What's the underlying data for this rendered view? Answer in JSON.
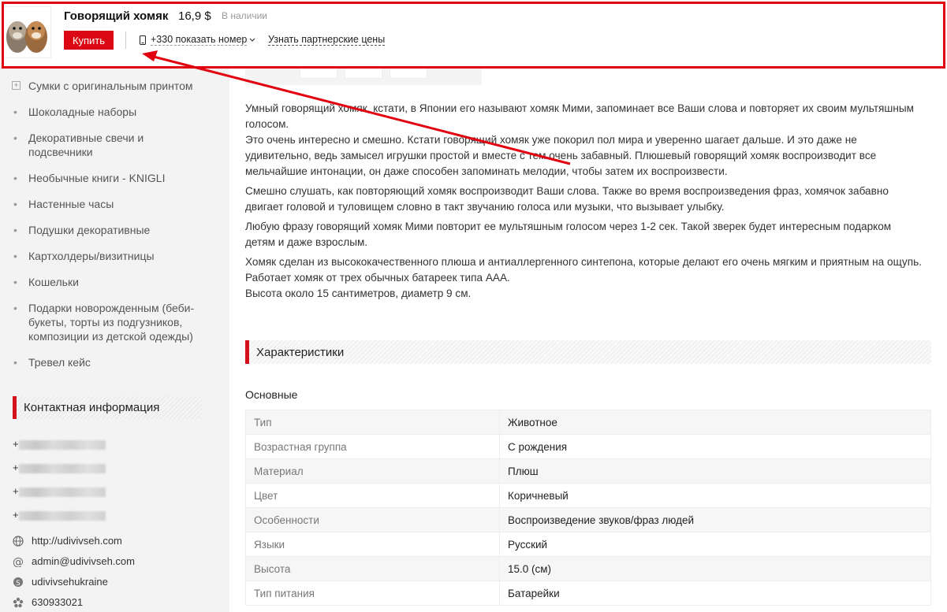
{
  "header": {
    "product_name": "Говорящий хомяк",
    "price": "16,9 $",
    "stock": "В наличии",
    "buy_label": "Купить",
    "phone": "+330 показать номер",
    "partner_link": "Узнать партнерские цены"
  },
  "sidebar": {
    "categories": [
      {
        "label": "Сумки с оригинальным принтом",
        "expandable": true
      },
      {
        "label": "Шоколадные наборы"
      },
      {
        "label": "Декоративные свечи и подсвечники"
      },
      {
        "label": "Необычные книги - KNIGLI"
      },
      {
        "label": "Настенные часы"
      },
      {
        "label": "Подушки декоративные"
      },
      {
        "label": "Картхолдеры/визитницы"
      },
      {
        "label": "Кошельки"
      },
      {
        "label": "Подарки новорожденным (беби-букеты, торты из подгузников, композиции из детской одежды)"
      },
      {
        "label": "Тревел кейс"
      }
    ],
    "contact_title": "Контактная информация",
    "phones": [
      "+",
      "+",
      "+",
      "+"
    ],
    "website": "http://udivivseh.com",
    "email": "admin@udivivseh.com",
    "skype": "udivivsehukraine",
    "icq": "630933021"
  },
  "description": {
    "paragraphs": [
      "Умный говорящий хомяк, кстати, в Японии его называют хомяк Мими, запоминает все Ваши слова и повторяет их своим мультяшным голосом.",
      "Это очень интересно и смешно. Кстати говорящий хомяк уже покорил пол мира и уверенно шагает дальше. И это даже не удивительно, ведь замысел игрушки простой и вместе с тем очень забавный. Плюшевый говорящий хомяк воспроизводит все мельчайшие интонации, он даже способен запоминать мелодии, чтобы затем их воспроизвести.",
      "Смешно слушать, как повторяющий хомяк воспроизводит Ваши слова. Также во время воспроизведения фраз, хомячок забавно двигает головой и туловищем словно в такт звучанию голоса или музыки, что вызывает улыбку.",
      "Любую фразу говорящий хомяк Мими повторит ее мультяшным голосом через 1-2 сек. Такой зверек будет интересным подарком детям и даже взрослым.",
      "Хомяк сделан из высококачественного плюша и антиаллергенного синтепона, которые делают его очень мягким и приятным на ощупь.",
      "Работает хомяк от трех обычных батареек типа ААА.",
      "Высота около 15 сантиметров, диаметр 9 см."
    ]
  },
  "specs": {
    "title": "Характеристики",
    "subtitle": "Основные",
    "rows": [
      {
        "k": "Тип",
        "v": "Животное"
      },
      {
        "k": "Возрастная группа",
        "v": "С рождения"
      },
      {
        "k": "Материал",
        "v": "Плюш"
      },
      {
        "k": "Цвет",
        "v": "Коричневый"
      },
      {
        "k": "Особенности",
        "v": "Воспроизведение звуков/фраз людей"
      },
      {
        "k": "Языки",
        "v": "Русский"
      },
      {
        "k": "Высота",
        "v": "15.0 (см)"
      },
      {
        "k": "Тип питания",
        "v": "Батарейки"
      }
    ]
  },
  "colors": {
    "accent": "#d4121b",
    "buy_button": "#dc0714",
    "annotation": "#e10010"
  }
}
